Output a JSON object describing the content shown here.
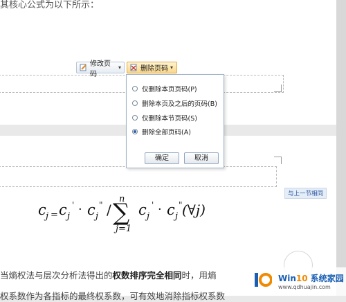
{
  "doc": {
    "top_line": "其核心公式为以下所示：",
    "body_line1_a": "当熵权法与层次分析法得出的",
    "body_line1_bold": "权数排序完全相同",
    "body_line1_b": "时，用熵",
    "body_line2": "权系数作为各指标的最终权系数，可有效地消除指标权系数"
  },
  "toolbar": {
    "modify_label": "修改页码",
    "delete_label": "删除页码",
    "arrow": "▾"
  },
  "dropdown": {
    "options": [
      {
        "label": "仅删除本页页码(P)",
        "checked": false
      },
      {
        "label": "删除本页及之后的页码(B)",
        "checked": false
      },
      {
        "label": "仅删除本节页码(S)",
        "checked": false
      },
      {
        "label": "删除全部页码(A)",
        "checked": true
      }
    ],
    "ok_label": "确定",
    "cancel_label": "取消"
  },
  "header_link": "与上一节相同",
  "formula": {
    "c": "c",
    "sub_j": "j",
    "eq": "=",
    "prime": "'",
    "dprime": "\"",
    "dot": "·",
    "slash": "/",
    "sigma": "∑",
    "sum_top": "n",
    "sum_bottom": "j=1",
    "forall": "(∀j)"
  },
  "watermark": {
    "title_a": "Win",
    "title_b": "10",
    "title_c": " 系统家园",
    "url": "www.qdhuajin.com"
  }
}
